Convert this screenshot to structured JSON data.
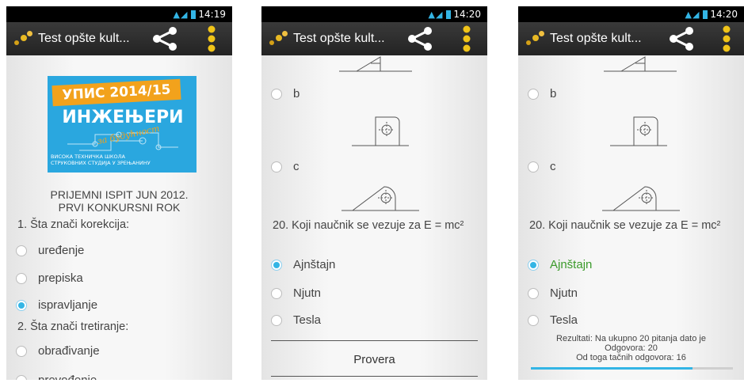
{
  "app": {
    "title": "Test opšte kult..."
  },
  "phone1": {
    "time": "14:19",
    "banner": {
      "tag": "УПИС 2014/15",
      "big": "ИНЖЕЊЕРИ",
      "cursive": "за будућност",
      "small1": "ВИСОКА ТЕХНИЧКА ШКОЛА",
      "small2": "СТРУКОВНИХ СТУДИЈА У ЗРЕЊАНИНУ"
    },
    "heading1": "PRIJEMNI ISPIT JUN 2012.",
    "heading2": "PRVI KONKURSNI ROK",
    "q1": "1. Šta znači korekcija:",
    "q1_options": [
      "uređenje",
      "prepiska",
      "ispravljanje"
    ],
    "q1_selected": 2,
    "q2": "2. Šta znači tretiranje:",
    "q2_options": [
      "obrađivanje",
      "prevođenje"
    ]
  },
  "phone2": {
    "time": "14:20",
    "opt_b": "b",
    "opt_c": "c",
    "q20": "20. Koji naučnik se vezuje za E = mc²",
    "q20_options": [
      "Ajnštajn",
      "Njutn",
      "Tesla"
    ],
    "q20_selected": 0,
    "check_button": "Provera"
  },
  "phone3": {
    "time": "14:20",
    "opt_b": "b",
    "opt_c": "c",
    "q20": "20. Koji naučnik se vezuje za E = mc²",
    "q20_options": [
      "Ajnštajn",
      "Njutn",
      "Tesla"
    ],
    "q20_selected": 0,
    "results1": "Rezultati: Na ukupno 20 pitanja dato je",
    "results2": "Odgovora: 20",
    "results3": "Od toga tačnih odgovora: 16",
    "progress_fraction": 0.8
  },
  "colors": {
    "accent": "#33b5e5",
    "correct": "#3a9a2a",
    "banner": "#2aa7df",
    "banner_tag": "#f2a21c"
  },
  "icons": {
    "share": "share-icon",
    "overflow": "overflow-menu-icon",
    "app": "app-logo-icon"
  }
}
